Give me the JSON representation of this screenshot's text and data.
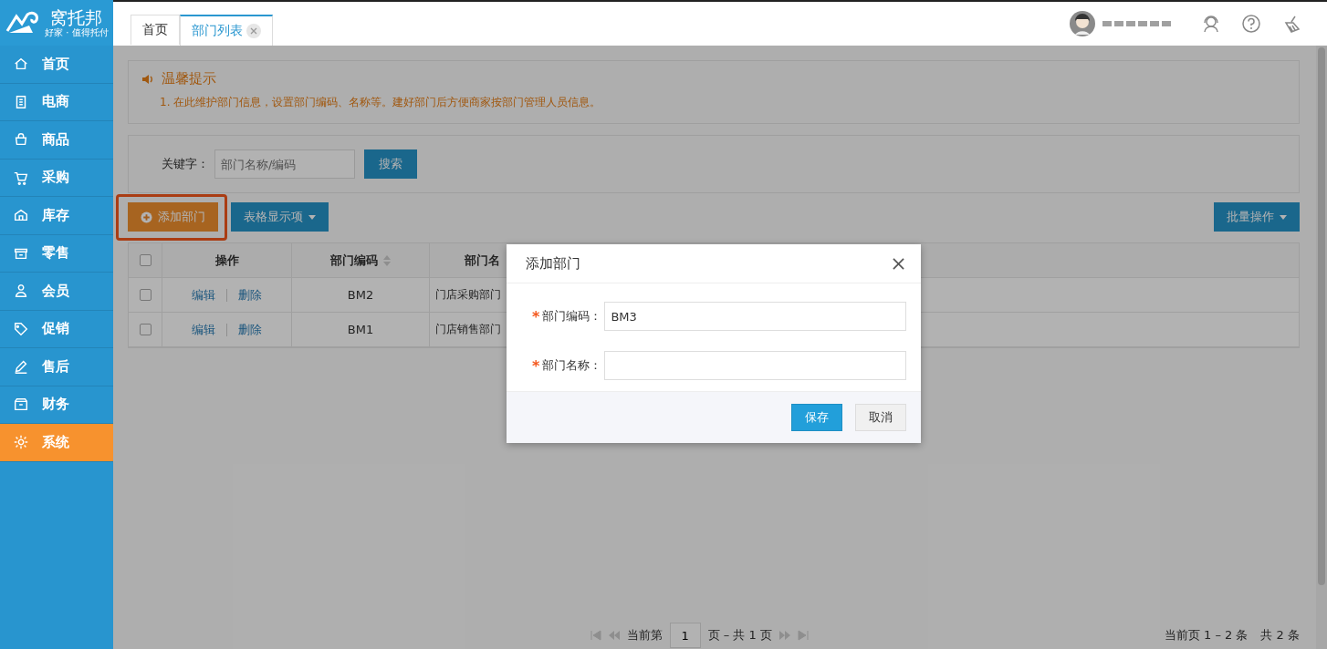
{
  "logo": {
    "name": "窝托邦",
    "slogan": "好家 · 值得托付"
  },
  "tabs": [
    {
      "label": "首页",
      "selected": false,
      "closable": false
    },
    {
      "label": "部门列表",
      "selected": true,
      "closable": true
    }
  ],
  "sidebar": {
    "items": [
      {
        "label": "首页",
        "selected": false
      },
      {
        "label": "电商",
        "selected": false
      },
      {
        "label": "商品",
        "selected": false
      },
      {
        "label": "采购",
        "selected": false
      },
      {
        "label": "库存",
        "selected": false
      },
      {
        "label": "零售",
        "selected": false
      },
      {
        "label": "会员",
        "selected": false
      },
      {
        "label": "促销",
        "selected": false
      },
      {
        "label": "售后",
        "selected": false
      },
      {
        "label": "财务",
        "selected": false
      },
      {
        "label": "系统",
        "selected": true
      }
    ]
  },
  "notice": {
    "title": "温馨提示",
    "lines": [
      "1. 在此维护部门信息，设置部门编码、名称等。建好部门后方便商家按部门管理人员信息。"
    ]
  },
  "search": {
    "label": "关键字：",
    "placeholder": "部门名称/编码",
    "button": "搜索"
  },
  "toolbar": {
    "add_button": "添加部门",
    "highlighted": true,
    "columns_button": "表格显示项",
    "batch_button": "批量操作"
  },
  "table": {
    "all_checked": false,
    "columns": [
      {
        "label": "操作",
        "sortable": false
      },
      {
        "label": "部门编码",
        "sortable": true
      },
      {
        "label": "部门名",
        "sortable": false
      }
    ],
    "rows": [
      {
        "checked": false,
        "actions": [
          "编辑",
          "删除"
        ],
        "code": "BM2",
        "name": "门店采购部门"
      },
      {
        "checked": false,
        "actions": [
          "编辑",
          "删除"
        ],
        "code": "BM1",
        "name": "门店销售部门"
      }
    ]
  },
  "pagination": {
    "prefix": "当前第",
    "page": "1",
    "suffix": "页 – 共 1 页",
    "summary": "当前页 1 – 2 条",
    "total": "共 2 条"
  },
  "dialog": {
    "title": "添加部门",
    "fields": [
      {
        "label": "部门编码：",
        "mark": "*",
        "value": "BM3"
      },
      {
        "label": "部门名称：",
        "mark": "*"
      }
    ],
    "buttons": [
      {
        "label": "保存",
        "kind": "primary"
      },
      {
        "label": "取消",
        "kind": "default"
      }
    ]
  }
}
